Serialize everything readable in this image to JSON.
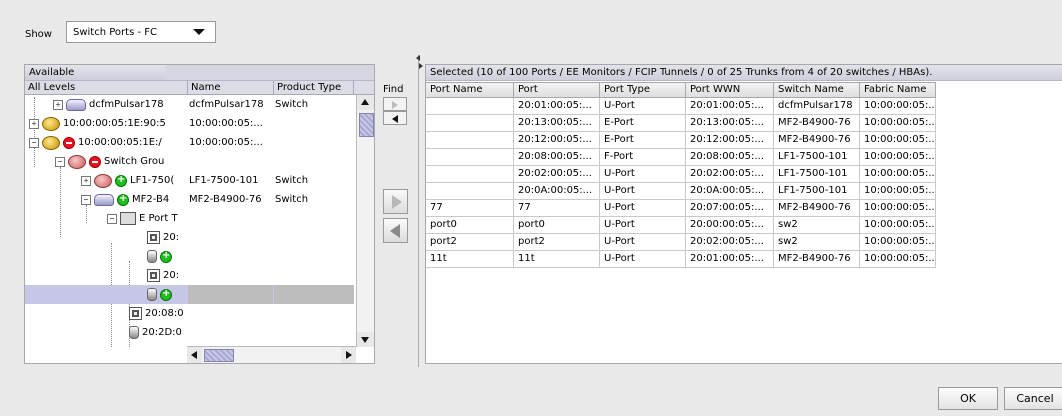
{
  "show": {
    "label": "Show",
    "selected": "Switch Ports - FC"
  },
  "available": {
    "title": "Available",
    "columns": [
      "All Levels",
      "Name",
      "Product Type"
    ],
    "rows": [
      {
        "label": "dcfmPulsar178",
        "name": "dcfmPulsar178",
        "type": "Switch"
      },
      {
        "label": "10:00:00:05:1E:90:5",
        "name": "10:00:00:05:...",
        "type": ""
      },
      {
        "label": "10:00:00:05:1E:/",
        "name": "10:00:00:05:...",
        "type": ""
      },
      {
        "label": "Switch Grou",
        "name": "",
        "type": ""
      },
      {
        "label": "LF1-750(",
        "name": "LF1-7500-101",
        "type": "Switch"
      },
      {
        "label": "MF2-B4",
        "name": "MF2-B4900-76",
        "type": "Switch"
      },
      {
        "label": "E Port T",
        "name": "",
        "type": ""
      },
      {
        "label": "20:",
        "name": "",
        "type": ""
      },
      {
        "label": "",
        "name": "",
        "type": ""
      },
      {
        "label": "20:",
        "name": "",
        "type": ""
      },
      {
        "label": "",
        "name": "",
        "type": ""
      },
      {
        "label": "20:08:0",
        "name": "",
        "type": ""
      },
      {
        "label": "20:2D:0",
        "name": "",
        "type": ""
      }
    ]
  },
  "find": {
    "label": "Find",
    "next": ">",
    "prev": "<"
  },
  "selected": {
    "title": "Selected (10 of 100  Ports / EE Monitors / FCIP Tunnels / 0 of 25 Trunks from 4 of 20 switches / HBAs).",
    "columns": [
      "Port Name",
      "Port",
      "Port Type",
      "Port WWN",
      "Switch Name",
      "Fabric Name"
    ],
    "rows": [
      [
        "",
        "20:01:00:05:...",
        "U-Port",
        "20:01:00:05:...",
        "dcfmPulsar178",
        "10:00:00:05:..."
      ],
      [
        "",
        "20:13:00:05:...",
        "E-Port",
        "20:13:00:05:...",
        "MF2-B4900-76",
        "10:00:00:05:..."
      ],
      [
        "",
        "20:12:00:05:...",
        "E-Port",
        "20:12:00:05:...",
        "MF2-B4900-76",
        "10:00:00:05:..."
      ],
      [
        "",
        "20:08:00:05:...",
        "F-Port",
        "20:08:00:05:...",
        "LF1-7500-101",
        "10:00:00:05:..."
      ],
      [
        "",
        "20:02:00:05:...",
        "U-Port",
        "20:02:00:05:...",
        "LF1-7500-101",
        "10:00:00:05:..."
      ],
      [
        "",
        "20:0A:00:05:...",
        "U-Port",
        "20:0A:00:05:...",
        "LF1-7500-101",
        "10:00:00:05:..."
      ],
      [
        "77",
        "77",
        "U-Port",
        "20:07:00:05:...",
        "MF2-B4900-76",
        "10:00:00:05:..."
      ],
      [
        "port0",
        "port0",
        "U-Port",
        "20:00:00:05:...",
        "sw2",
        "10:00:00:05:..."
      ],
      [
        "port2",
        "port2",
        "U-Port",
        "20:02:00:05:...",
        "sw2",
        "10:00:00:05:..."
      ],
      [
        "11t",
        "11t",
        "U-Port",
        "20:01:00:05:...",
        "MF2-B4900-76",
        "10:00:00:05:..."
      ]
    ]
  },
  "buttons": {
    "ok": "OK",
    "cancel": "Cancel"
  }
}
